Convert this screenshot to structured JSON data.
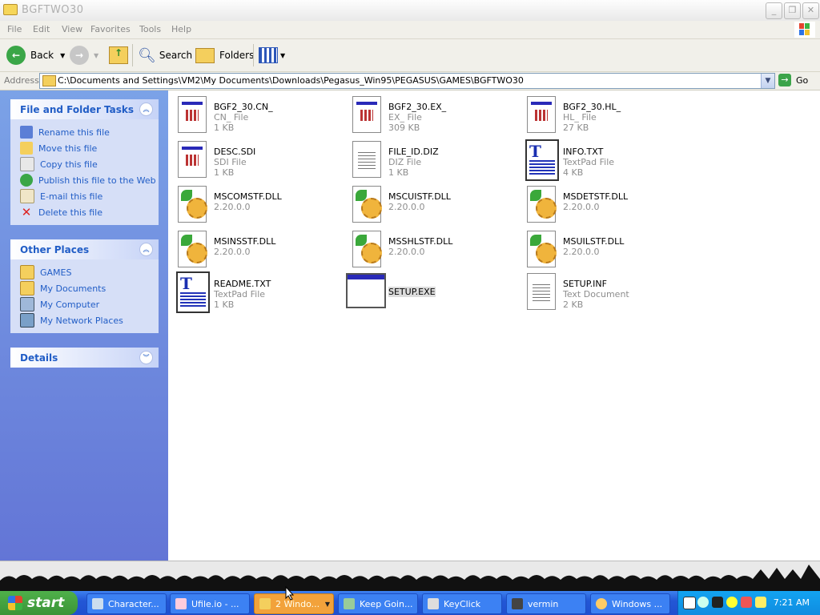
{
  "window": {
    "title": "BGFTWO30",
    "buttons": [
      "_",
      "❐",
      "✕"
    ]
  },
  "menu": [
    "File",
    "Edit",
    "View",
    "Favorites",
    "Tools",
    "Help"
  ],
  "toolbar": {
    "back": "Back",
    "search": "Search",
    "folders": "Folders"
  },
  "address": {
    "label": "Address",
    "path": "C:\\Documents and Settings\\VM2\\My Documents\\Downloads\\Pegasus_Win95\\PEGASUS\\GAMES\\BGFTWO30",
    "go": "Go"
  },
  "panels": {
    "tasks": {
      "title": "File and Folder Tasks",
      "items": [
        "Rename this file",
        "Move this file",
        "Copy this file",
        "Publish this file to the Web",
        "E-mail this file",
        "Delete this file"
      ]
    },
    "places": {
      "title": "Other Places",
      "items": [
        "GAMES",
        "My Documents",
        "My Computer",
        "My Network Places"
      ]
    },
    "details": {
      "title": "Details"
    }
  },
  "files": [
    {
      "name": "BGF2_30.CN_",
      "type": "CN_ File",
      "size": "1 KB",
      "icon": "doc"
    },
    {
      "name": "BGF2_30.EX_",
      "type": "EX_ File",
      "size": "309 KB",
      "icon": "doc"
    },
    {
      "name": "BGF2_30.HL_",
      "type": "HL_ File",
      "size": "27 KB",
      "icon": "doc"
    },
    {
      "name": "DESC.SDI",
      "type": "SDI File",
      "size": "1 KB",
      "icon": "doc"
    },
    {
      "name": "FILE_ID.DIZ",
      "type": "DIZ File",
      "size": "1 KB",
      "icon": "txt"
    },
    {
      "name": "INFO.TXT",
      "type": "TextPad File",
      "size": "4 KB",
      "icon": "tpad"
    },
    {
      "name": "MSCOMSTF.DLL",
      "type": "2.20.0.0",
      "size": "",
      "icon": "dll"
    },
    {
      "name": "MSCUISTF.DLL",
      "type": "2.20.0.0",
      "size": "",
      "icon": "dll"
    },
    {
      "name": "MSDETSTF.DLL",
      "type": "2.20.0.0",
      "size": "",
      "icon": "dll"
    },
    {
      "name": "MSINSSTF.DLL",
      "type": "2.20.0.0",
      "size": "",
      "icon": "dll"
    },
    {
      "name": "MSSHLSTF.DLL",
      "type": "2.20.0.0",
      "size": "",
      "icon": "dll"
    },
    {
      "name": "MSUILSTF.DLL",
      "type": "2.20.0.0",
      "size": "",
      "icon": "dll"
    },
    {
      "name": "README.TXT",
      "type": "TextPad File",
      "size": "1 KB",
      "icon": "tpad"
    },
    {
      "name": "SETUP.EXE",
      "type": "",
      "size": "",
      "icon": "exe"
    },
    {
      "name": "SETUP.INF",
      "type": "Text Document",
      "size": "2 KB",
      "icon": "txt"
    }
  ],
  "taskbar": {
    "start": "start",
    "buttons": [
      "Character...",
      "Ufile.io - ...",
      "2 Windo...",
      "Keep Goin...",
      "KeyClick",
      "vermin",
      "Windows ..."
    ],
    "clock": "7:21 AM"
  }
}
